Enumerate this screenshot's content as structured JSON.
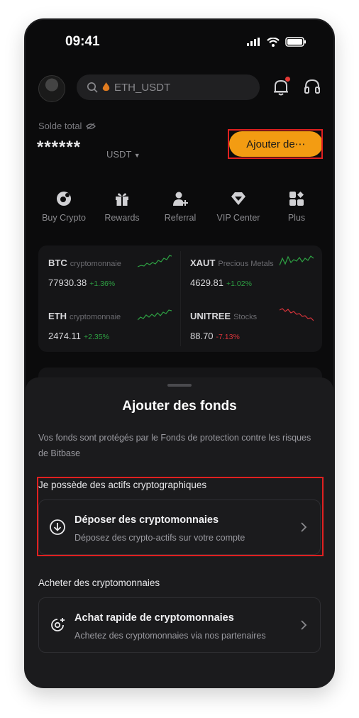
{
  "status": {
    "time": "09:41"
  },
  "header": {
    "search_placeholder": "ETH_USDT"
  },
  "balance": {
    "label": "Solde total",
    "value": "******",
    "unit": "USDT",
    "add_button": "Ajouter de⋯"
  },
  "quick_actions": [
    {
      "label": "Buy Crypto",
      "icon": "buy-crypto-icon"
    },
    {
      "label": "Rewards",
      "icon": "gift-icon"
    },
    {
      "label": "Referral",
      "icon": "add-user-icon"
    },
    {
      "label": "VIP Center",
      "icon": "diamond-icon"
    },
    {
      "label": "Plus",
      "icon": "grid-icon"
    }
  ],
  "markets": [
    {
      "symbol": "BTC",
      "category": "cryptomonnaie",
      "price": "77930.38",
      "change": "+1.36%",
      "trend": "up"
    },
    {
      "symbol": "XAUT",
      "category": "Precious Metals",
      "price": "4629.81",
      "change": "+1.02%",
      "trend": "up"
    },
    {
      "symbol": "ETH",
      "category": "cryptomonnaie",
      "price": "2474.11",
      "change": "+2.35%",
      "trend": "up"
    },
    {
      "symbol": "UNITREE",
      "category": "Stocks",
      "price": "88.70",
      "change": "-7.13%",
      "trend": "down"
    }
  ],
  "sheet": {
    "title": "Ajouter des fonds",
    "note": "Vos fonds sont protégés par le Fonds de protection contre les risques de Bitbase",
    "section1_title": "Je possède des actifs cryptographiques",
    "deposit": {
      "title": "Déposer des cryptomonnaies",
      "subtitle": "Déposez des crypto-actifs sur votre compte"
    },
    "section2_title": "Acheter des cryptomonnaies",
    "buy": {
      "title": "Achat rapide de cryptomonnaies",
      "subtitle": "Achetez des cryptomonnaies via nos partenaires"
    }
  },
  "colors": {
    "accent": "#f39c12",
    "up": "#2ea043",
    "down": "#d9343b",
    "highlight": "#e02020"
  }
}
